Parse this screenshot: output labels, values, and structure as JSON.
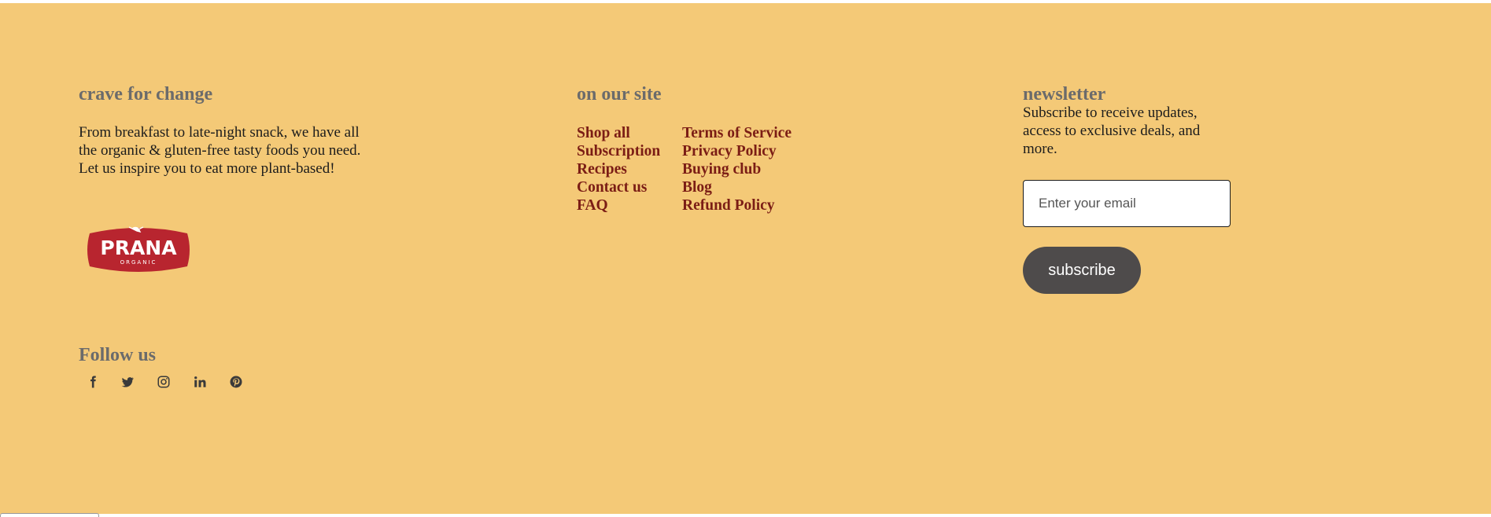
{
  "about": {
    "heading": "crave for change",
    "description": "From breakfast to late-night snack, we have all the organic & gluten-free tasty foods you need. Let us inspire you to eat more plant-based!",
    "logo": {
      "wordmark": "PRANA",
      "subline": "ORGANIC",
      "color": "#b8252f"
    }
  },
  "site": {
    "heading": "on our site",
    "links_col1": [
      "Shop all",
      "Subscription",
      "Recipes",
      "Contact us",
      "FAQ"
    ],
    "links_col2": [
      "Terms of Service",
      "Privacy Policy",
      "Buying club",
      "Blog",
      "Refund Policy"
    ]
  },
  "newsletter": {
    "heading": "newsletter",
    "description": "Subscribe to receive updates, access to exclusive deals, and more.",
    "email_placeholder": "Enter your email",
    "subscribe_label": "subscribe"
  },
  "follow": {
    "heading": "Follow us",
    "icons": [
      "facebook-icon",
      "twitter-icon",
      "instagram-icon",
      "linkedin-icon",
      "pinterest-icon"
    ]
  },
  "colors": {
    "background": "#f4c977",
    "heading": "#6b6b6b",
    "link": "#7b1d15",
    "button": "#4e4b4b",
    "logo": "#b8252f"
  }
}
